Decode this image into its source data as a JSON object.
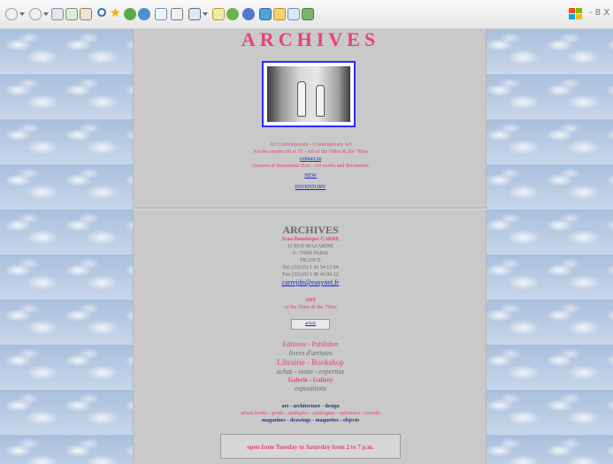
{
  "browser": {
    "toolbar_right_text": "- 8 X"
  },
  "site": {
    "title": "ARCHIVES",
    "intro": {
      "line1": "Art Contemporain - Contemporary Art",
      "line2": "Art des années 60 et 70 - Art of the '60ies & the '70ies",
      "contact": "contact us",
      "line3": "Oeuvres et documents d'art - Art works and documents",
      "new": "NEW",
      "inventory": "INVENTORY"
    },
    "address": {
      "name": "ARCHIVES",
      "person": "Jean-Dominique CARRE",
      "street": "12 RUE MAZARINE",
      "city": "F- 75006 PARIS",
      "country": "FRANCE",
      "tel": "Tel. (33) (0) 1 43 54 12 84",
      "fax": "Fax (33) (0) 1 40 46 84 22",
      "email": "carrejdn@easynet.fr"
    },
    "art": {
      "heading": "ART",
      "sub": "of the '60ies & the '70ies",
      "artists_button": "artists"
    },
    "sections": {
      "editions": "Editions - Publisher",
      "editions_sub": "livres d'artistes",
      "librairie": "Librairie - Bookshop",
      "librairie_sub": "achat - vente - expertise",
      "galerie": "Galerie - Gallery",
      "galerie_sub": "expositions"
    },
    "categories": {
      "line1": "art - architecture - design",
      "line2": "artists books - prints - multiples - catalogues - ephemera - records",
      "line3": "magazines - drawings - maquettes - objects"
    },
    "hours": "open from Tuesday to Saturday from 2 to 7 p.m."
  },
  "colors": {
    "pink": "#e8407f",
    "link": "#2222cc",
    "column_bg": "#c9c9c9"
  },
  "icons": [
    "back-icon",
    "forward-icon",
    "stop-icon",
    "refresh-icon",
    "home-icon",
    "search-icon",
    "favorites-icon",
    "media-icon",
    "history-icon",
    "mail-icon",
    "print-icon",
    "edit-icon",
    "discuss-icon",
    "messenger-icon",
    "research-icon",
    "windows-logo-icon"
  ]
}
